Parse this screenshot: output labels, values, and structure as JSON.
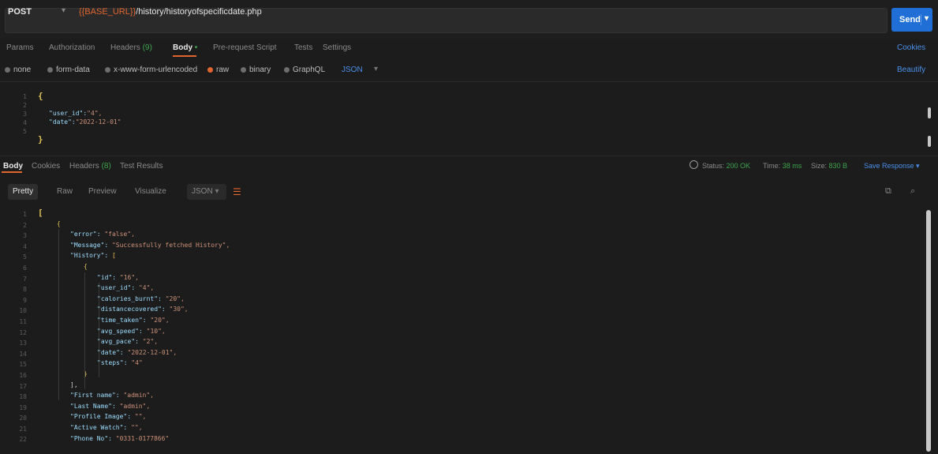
{
  "request": {
    "method": "POST",
    "url_var": "{{BASE_URL}}",
    "url_path": "/history/historyofspecificdate.php",
    "send_label": "Send"
  },
  "request_tabs": [
    {
      "label": "Params",
      "active": false
    },
    {
      "label": "Authorization",
      "active": false
    },
    {
      "label": "Headers",
      "count": "(9)",
      "active": false
    },
    {
      "label": "Body",
      "dot": "•",
      "active": true
    },
    {
      "label": "Pre-request Script",
      "active": false
    },
    {
      "label": "Tests",
      "active": false
    },
    {
      "label": "Settings",
      "active": false
    }
  ],
  "cookies_label": "Cookies",
  "body_types": [
    {
      "label": "none",
      "selected": false
    },
    {
      "label": "form-data",
      "selected": false
    },
    {
      "label": "x-www-form-urlencoded",
      "selected": false
    },
    {
      "label": "raw",
      "selected": true
    },
    {
      "label": "binary",
      "selected": false
    },
    {
      "label": "GraphQL",
      "selected": false
    }
  ],
  "raw_format": "JSON",
  "beautify_label": "Beautify",
  "request_body": {
    "line_numbers": [
      "1",
      "2",
      "3",
      "4",
      "5"
    ],
    "user_id_key": "\"user_id\":",
    "user_id_val": "\"4\",",
    "date_key": "\"date\":",
    "date_val": "\"2022-12-01\""
  },
  "response_tabs": [
    {
      "label": "Body",
      "active": true
    },
    {
      "label": "Cookies",
      "active": false
    },
    {
      "label": "Headers",
      "count": "(8)",
      "active": false
    },
    {
      "label": "Test Results",
      "active": false
    }
  ],
  "response_status": {
    "status_label": "Status:",
    "status_value": "200 OK",
    "time_label": "Time:",
    "time_value": "38 ms",
    "size_label": "Size:",
    "size_value": "830 B",
    "save_label": "Save Response"
  },
  "view_modes": [
    {
      "label": "Pretty",
      "active": true
    },
    {
      "label": "Raw",
      "active": false
    },
    {
      "label": "Preview",
      "active": false
    },
    {
      "label": "Visualize",
      "active": false
    }
  ],
  "response_format": "JSON",
  "response_body": {
    "line_numbers": [
      "1",
      "2",
      "3",
      "4",
      "5",
      "6",
      "7",
      "8",
      "9",
      "10",
      "11",
      "12",
      "13",
      "14",
      "15",
      "16",
      "17",
      "18",
      "19",
      "20",
      "21",
      "22"
    ],
    "lines": [
      {
        "indent": 0,
        "text": "{",
        "kind": "bracket"
      },
      {
        "indent": 1,
        "key": "\"error\":",
        "val": "\"false\","
      },
      {
        "indent": 1,
        "key": "\"Message\":",
        "val": "\"Successfully fetched History\","
      },
      {
        "indent": 1,
        "key": "\"History\":",
        "val": "[",
        "kind": "open"
      },
      {
        "indent": 2,
        "text": "{",
        "kind": "bracket"
      },
      {
        "indent": 3,
        "key": "\"id\":",
        "val": "\"16\","
      },
      {
        "indent": 3,
        "key": "\"user_id\":",
        "val": "\"4\","
      },
      {
        "indent": 3,
        "key": "\"calories_burnt\":",
        "val": "\"20\","
      },
      {
        "indent": 3,
        "key": "\"distancecovered\":",
        "val": "\"30\","
      },
      {
        "indent": 3,
        "key": "\"time_taken\":",
        "val": "\"20\","
      },
      {
        "indent": 3,
        "key": "\"avg_speed\":",
        "val": "\"10\","
      },
      {
        "indent": 3,
        "key": "\"avg_pace\":",
        "val": "\"2\","
      },
      {
        "indent": 3,
        "key": "\"date\":",
        "val": "\"2022-12-01\","
      },
      {
        "indent": 3,
        "key": "\"steps\":",
        "val": "\"4\""
      },
      {
        "indent": 2,
        "text": "}",
        "kind": "bracket"
      },
      {
        "indent": 1,
        "text": "],",
        "kind": "plain"
      },
      {
        "indent": 1,
        "key": "\"First name\":",
        "val": "\"admin\","
      },
      {
        "indent": 1,
        "key": "\"Last Name\":",
        "val": "\"admin\","
      },
      {
        "indent": 1,
        "key": "\"Profile Image\":",
        "val": "\"\","
      },
      {
        "indent": 1,
        "key": "\"Active Watch\":",
        "val": "\"\","
      },
      {
        "indent": 1,
        "key": "\"Phone No\":",
        "val": "\"0331-0177866\""
      }
    ]
  },
  "colors": {
    "accent": "#e0652f",
    "link": "#4b8fe8",
    "send": "#1f6fd6",
    "ok": "#3fa34d"
  }
}
